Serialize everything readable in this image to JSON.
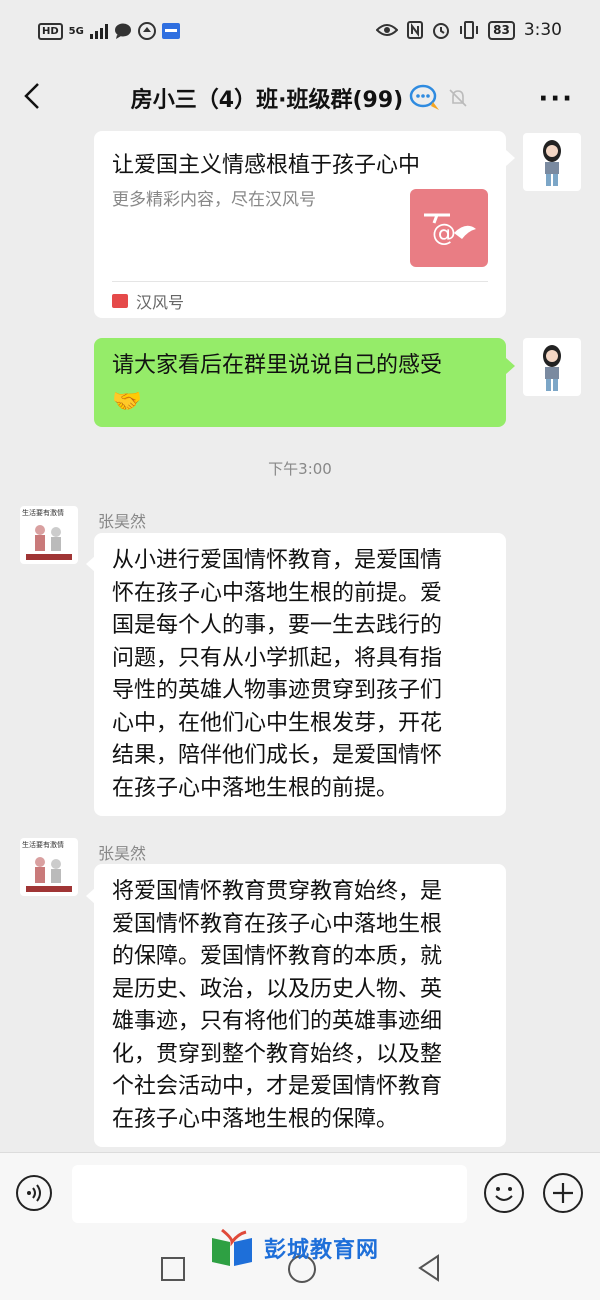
{
  "status_bar": {
    "hd_label": "HD",
    "network": "5G",
    "battery": "83",
    "time": "3:30"
  },
  "navbar": {
    "title": "房小三（4）班·班级群(99)"
  },
  "messages": {
    "card": {
      "title": "让爱国主义情感根植于孩子心中",
      "description": "更多精彩内容，尽在汉风号",
      "source": "汉风号"
    },
    "own_text": {
      "text": "请大家看后在群里说说自己的感受",
      "emoji": "🤝"
    },
    "timestamp": "下午3:00",
    "msg1": {
      "sender": "张昊然",
      "avatar_caption": "生活要有激情",
      "lines": [
        "从小进行爱国情怀教育，是爱国情",
        "怀在孩子心中落地生根的前提。爱",
        "国是每个人的事，要一生去践行的",
        "问题，只有从小学抓起，将具有指",
        "导性的英雄人物事迹贯穿到孩子们",
        "心中，在他们心中生根发芽，开花",
        "结果，陪伴他们成长，是爱国情怀",
        "在孩子心中落地生根的前提。"
      ]
    },
    "msg2": {
      "sender": "张昊然",
      "avatar_caption": "生活要有激情",
      "lines": [
        "将爱国情怀教育贯穿教育始终，是",
        "爱国情怀教育在孩子心中落地生根",
        "的保障。爱国情怀教育的本质，就",
        "是历史、政治，以及历史人物、英",
        "雄事迹，只有将他们的英雄事迹细",
        "化，贯穿到整个教育始终，以及整",
        "个社会活动中，才是爱国情怀教育",
        "在孩子心中落地生根的保障。"
      ]
    }
  },
  "input_bar": {
    "placeholder": ""
  },
  "watermark": {
    "text": "彭城教育网"
  },
  "colors": {
    "background": "#ededed",
    "own_bubble": "#95ec69",
    "other_bubble": "#ffffff",
    "card_thumb": "#e97d84",
    "watermark": "#1e6fd9"
  }
}
